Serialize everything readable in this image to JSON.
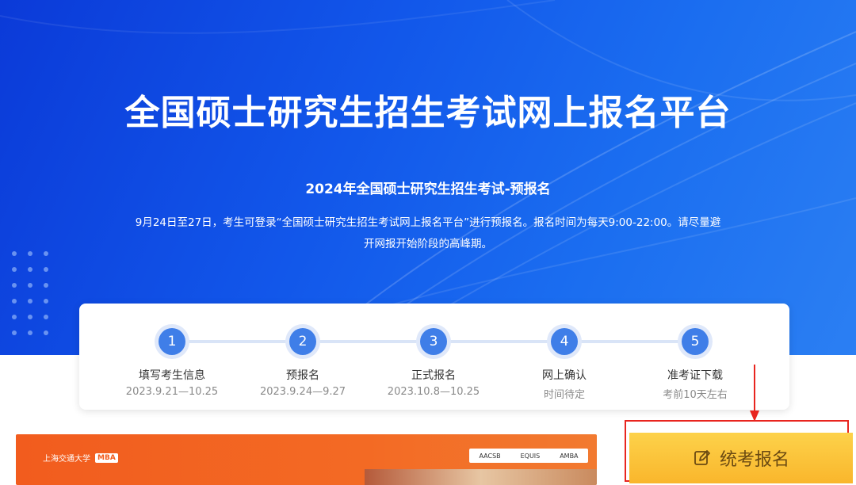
{
  "hero": {
    "title": "全国硕士研究生招生考试网上报名平台",
    "subtitle": "2024年全国硕士研究生招生考试-预报名",
    "description_line1": "9月24日至27日，考生可登录“全国硕士研究生招生考试网上报名平台”进行预报名。报名时间为每天9:00-22:00。请尽量避",
    "description_line2": "开网报开始阶段的高峰期。"
  },
  "steps": [
    {
      "number": "1",
      "name": "填写考生信息",
      "date": "2023.9.21—10.25"
    },
    {
      "number": "2",
      "name": "预报名",
      "date": "2023.9.24—9.27"
    },
    {
      "number": "3",
      "name": "正式报名",
      "date": "2023.10.8—10.25"
    },
    {
      "number": "4",
      "name": "网上确认",
      "date": "时间待定"
    },
    {
      "number": "5",
      "name": "准考证下载",
      "date": "考前10天左右"
    }
  ],
  "banner": {
    "logo_text": "上海交通大学",
    "logo_badge": "MBA",
    "accreditations": [
      "AACSB",
      "EQUIS",
      "AMBA"
    ]
  },
  "register_button": {
    "label": "统考报名",
    "icon": "edit-icon"
  },
  "colors": {
    "hero_blue": "#1257ea",
    "step_blue": "#3f7ee8",
    "button_yellow": "#f9b62c",
    "highlight_red": "#e8251f"
  }
}
